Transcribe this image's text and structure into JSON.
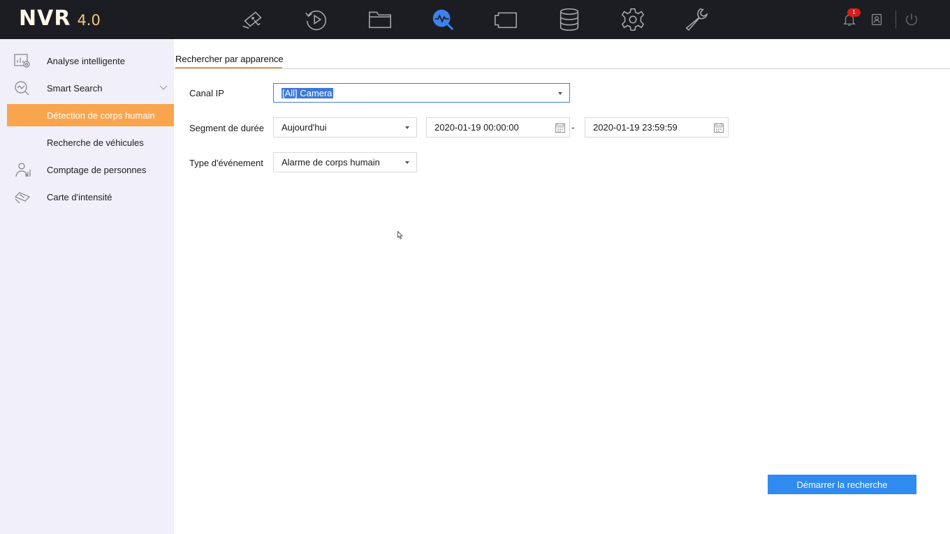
{
  "app": {
    "logo_main": "NVR",
    "logo_version": "4.0"
  },
  "topnav": {
    "items": [
      {
        "name": "live-view",
        "icon": "camera-icon"
      },
      {
        "name": "playback",
        "icon": "playback-icon"
      },
      {
        "name": "file-management",
        "icon": "folder-icon"
      },
      {
        "name": "smart-analysis",
        "icon": "search-analysis-icon",
        "active": true
      },
      {
        "name": "camera",
        "icon": "camera-box-icon"
      },
      {
        "name": "storage",
        "icon": "database-icon"
      },
      {
        "name": "configuration",
        "icon": "gear-icon"
      },
      {
        "name": "maintenance",
        "icon": "wrench-icon"
      }
    ],
    "notification_count": "1",
    "right_icons": [
      "bell-icon",
      "user-icon",
      "power-icon"
    ]
  },
  "sidebar": {
    "items": [
      {
        "label": "Analyse intelligente",
        "icon": "analysis-icon"
      },
      {
        "label": "Smart Search",
        "icon": "smart-search-icon",
        "expandable": true
      },
      {
        "label": "Détection de corps humain",
        "active": true
      },
      {
        "label": "Recherche de véhicules"
      },
      {
        "label": "Comptage de personnes",
        "icon": "people-count-icon"
      },
      {
        "label": "Carte d'intensité",
        "icon": "heatmap-icon"
      }
    ]
  },
  "main": {
    "tab_label": "Rechercher par apparence",
    "fields": {
      "channel_label": "Canal IP",
      "channel_value": "[All] Camera",
      "duration_label": "Segment de durée",
      "duration_value": "Aujourd'hui",
      "start_time": "2020-01-19 00:00:00",
      "range_separator": "-",
      "end_time": "2020-01-19 23:59:59",
      "event_label": "Type d'événement",
      "event_value": "Alarme de corps humain"
    },
    "start_button": "Démarrer la recherche"
  },
  "colors": {
    "topbar": "#1c1d22",
    "sidebar_bg": "#f1f0fa",
    "active_item": "#f9a54e",
    "tab_accent": "#f39a3b",
    "primary_button": "#2f8bf0",
    "active_nav_icon": "#3c82f0"
  }
}
